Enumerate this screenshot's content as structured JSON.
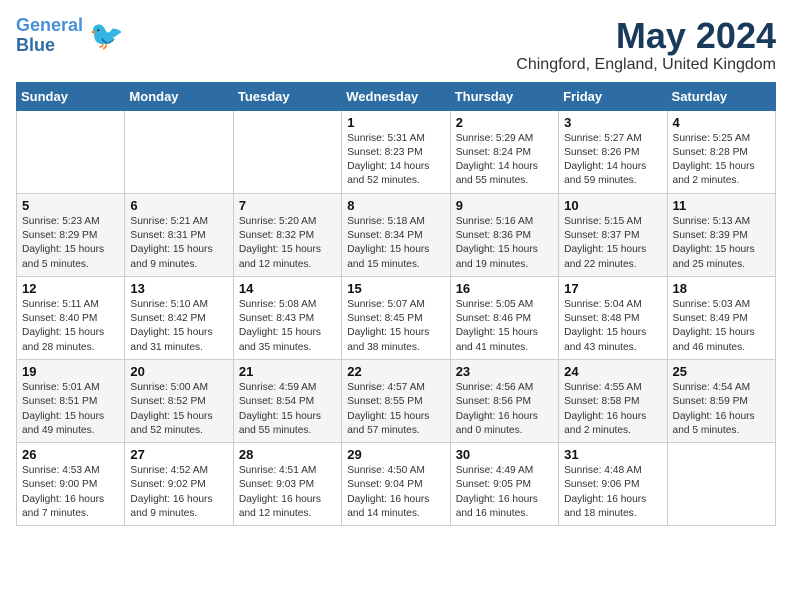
{
  "logo": {
    "line1": "General",
    "line2": "Blue"
  },
  "title": "May 2024",
  "location": "Chingford, England, United Kingdom",
  "weekdays": [
    "Sunday",
    "Monday",
    "Tuesday",
    "Wednesday",
    "Thursday",
    "Friday",
    "Saturday"
  ],
  "weeks": [
    [
      {
        "day": "",
        "info": ""
      },
      {
        "day": "",
        "info": ""
      },
      {
        "day": "",
        "info": ""
      },
      {
        "day": "1",
        "info": "Sunrise: 5:31 AM\nSunset: 8:23 PM\nDaylight: 14 hours\nand 52 minutes."
      },
      {
        "day": "2",
        "info": "Sunrise: 5:29 AM\nSunset: 8:24 PM\nDaylight: 14 hours\nand 55 minutes."
      },
      {
        "day": "3",
        "info": "Sunrise: 5:27 AM\nSunset: 8:26 PM\nDaylight: 14 hours\nand 59 minutes."
      },
      {
        "day": "4",
        "info": "Sunrise: 5:25 AM\nSunset: 8:28 PM\nDaylight: 15 hours\nand 2 minutes."
      }
    ],
    [
      {
        "day": "5",
        "info": "Sunrise: 5:23 AM\nSunset: 8:29 PM\nDaylight: 15 hours\nand 5 minutes."
      },
      {
        "day": "6",
        "info": "Sunrise: 5:21 AM\nSunset: 8:31 PM\nDaylight: 15 hours\nand 9 minutes."
      },
      {
        "day": "7",
        "info": "Sunrise: 5:20 AM\nSunset: 8:32 PM\nDaylight: 15 hours\nand 12 minutes."
      },
      {
        "day": "8",
        "info": "Sunrise: 5:18 AM\nSunset: 8:34 PM\nDaylight: 15 hours\nand 15 minutes."
      },
      {
        "day": "9",
        "info": "Sunrise: 5:16 AM\nSunset: 8:36 PM\nDaylight: 15 hours\nand 19 minutes."
      },
      {
        "day": "10",
        "info": "Sunrise: 5:15 AM\nSunset: 8:37 PM\nDaylight: 15 hours\nand 22 minutes."
      },
      {
        "day": "11",
        "info": "Sunrise: 5:13 AM\nSunset: 8:39 PM\nDaylight: 15 hours\nand 25 minutes."
      }
    ],
    [
      {
        "day": "12",
        "info": "Sunrise: 5:11 AM\nSunset: 8:40 PM\nDaylight: 15 hours\nand 28 minutes."
      },
      {
        "day": "13",
        "info": "Sunrise: 5:10 AM\nSunset: 8:42 PM\nDaylight: 15 hours\nand 31 minutes."
      },
      {
        "day": "14",
        "info": "Sunrise: 5:08 AM\nSunset: 8:43 PM\nDaylight: 15 hours\nand 35 minutes."
      },
      {
        "day": "15",
        "info": "Sunrise: 5:07 AM\nSunset: 8:45 PM\nDaylight: 15 hours\nand 38 minutes."
      },
      {
        "day": "16",
        "info": "Sunrise: 5:05 AM\nSunset: 8:46 PM\nDaylight: 15 hours\nand 41 minutes."
      },
      {
        "day": "17",
        "info": "Sunrise: 5:04 AM\nSunset: 8:48 PM\nDaylight: 15 hours\nand 43 minutes."
      },
      {
        "day": "18",
        "info": "Sunrise: 5:03 AM\nSunset: 8:49 PM\nDaylight: 15 hours\nand 46 minutes."
      }
    ],
    [
      {
        "day": "19",
        "info": "Sunrise: 5:01 AM\nSunset: 8:51 PM\nDaylight: 15 hours\nand 49 minutes."
      },
      {
        "day": "20",
        "info": "Sunrise: 5:00 AM\nSunset: 8:52 PM\nDaylight: 15 hours\nand 52 minutes."
      },
      {
        "day": "21",
        "info": "Sunrise: 4:59 AM\nSunset: 8:54 PM\nDaylight: 15 hours\nand 55 minutes."
      },
      {
        "day": "22",
        "info": "Sunrise: 4:57 AM\nSunset: 8:55 PM\nDaylight: 15 hours\nand 57 minutes."
      },
      {
        "day": "23",
        "info": "Sunrise: 4:56 AM\nSunset: 8:56 PM\nDaylight: 16 hours\nand 0 minutes."
      },
      {
        "day": "24",
        "info": "Sunrise: 4:55 AM\nSunset: 8:58 PM\nDaylight: 16 hours\nand 2 minutes."
      },
      {
        "day": "25",
        "info": "Sunrise: 4:54 AM\nSunset: 8:59 PM\nDaylight: 16 hours\nand 5 minutes."
      }
    ],
    [
      {
        "day": "26",
        "info": "Sunrise: 4:53 AM\nSunset: 9:00 PM\nDaylight: 16 hours\nand 7 minutes."
      },
      {
        "day": "27",
        "info": "Sunrise: 4:52 AM\nSunset: 9:02 PM\nDaylight: 16 hours\nand 9 minutes."
      },
      {
        "day": "28",
        "info": "Sunrise: 4:51 AM\nSunset: 9:03 PM\nDaylight: 16 hours\nand 12 minutes."
      },
      {
        "day": "29",
        "info": "Sunrise: 4:50 AM\nSunset: 9:04 PM\nDaylight: 16 hours\nand 14 minutes."
      },
      {
        "day": "30",
        "info": "Sunrise: 4:49 AM\nSunset: 9:05 PM\nDaylight: 16 hours\nand 16 minutes."
      },
      {
        "day": "31",
        "info": "Sunrise: 4:48 AM\nSunset: 9:06 PM\nDaylight: 16 hours\nand 18 minutes."
      },
      {
        "day": "",
        "info": ""
      }
    ]
  ]
}
